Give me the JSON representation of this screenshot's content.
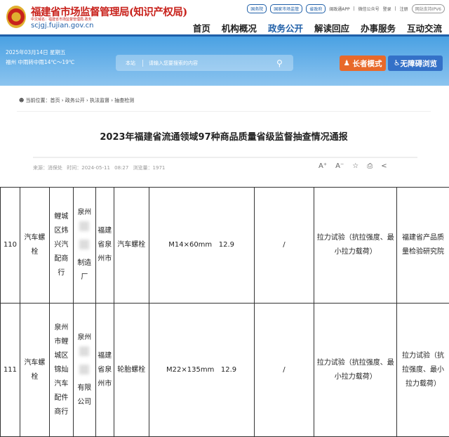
{
  "header": {
    "title": "福建省市场监督管理局(知识产权局)",
    "subtitle": "中文域名：福建省市场监督管理局.政务",
    "url": "scjgj.fujian.gov.cn",
    "top_links": [
      "国务院",
      "国家市场监管",
      "省政府"
    ],
    "app": "闽政通APP",
    "wechat": "微信公众号",
    "login": "登录",
    "register": "注册",
    "ipv6": "网站支持IPV6",
    "nav": [
      "首页",
      "机构概况",
      "政务公开",
      "解读回应",
      "办事服务",
      "互动交流"
    ]
  },
  "banner": {
    "date": "2025年03月14日 星期五",
    "weather": "福州 中雨转中雨14℃～19℃",
    "search_scope": "本站",
    "search_placeholder": "请输入您要搜索的内容",
    "elder_mode": "长者模式",
    "accessible": "无障碍浏览"
  },
  "article": {
    "breadcrumb": "当前位置：首页 › 政务公开 › 执法监督 › 抽查检测",
    "title": "2023年福建省流通领域97种商品质量省级监督抽查情况通报",
    "source": "来源：消保处",
    "time": "时间：2024-05-11 08:27",
    "views": "浏览量：1971"
  },
  "rows": [
    {
      "no": "110",
      "product": "汽车螺栓",
      "seller": "鲤城区炜兴汽配商行",
      "maker_a": "泉州",
      "maker_b": "制造厂",
      "region": "福建省泉州市",
      "sample": "汽车螺栓",
      "spec": "M14×60mm",
      "grade": "12.9",
      "brand": "/",
      "items": "拉力试验（抗拉强度、最小拉力载荷）",
      "lab": "福建省产品质量检验研究院"
    },
    {
      "no": "111",
      "product": "汽车螺栓",
      "seller": "泉州市鲤城区锦灿汽车配件商行",
      "maker_a": "泉州",
      "maker_b": "有限公司",
      "region": "福建省泉州市",
      "sample": "轮胎螺栓",
      "spec": "M22×135mm",
      "grade": "12.9",
      "brand": "/",
      "items": "拉力试验（抗拉强度、最小拉力载荷）",
      "lab": "拉力试验（抗拉强度、最小拉力载荷）"
    }
  ]
}
